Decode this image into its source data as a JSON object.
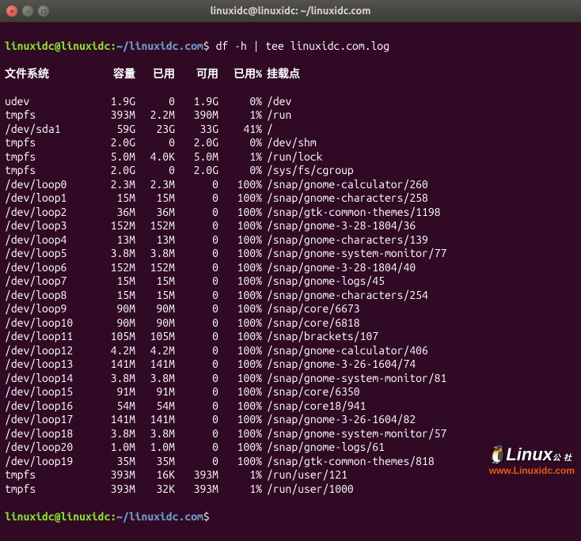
{
  "window": {
    "title": "linuxidc@linuxidc: ~/linuxidc.com"
  },
  "prompt": {
    "user_host": "linuxidc@linuxidc",
    "colon": ":",
    "path": "~/linuxidc.com",
    "dollar": "$",
    "command": "df -h | tee linuxidc.com.log"
  },
  "headers": {
    "filesystem": "文件系统",
    "size": "容量",
    "used": "已用",
    "avail": "可用",
    "use_pct": "已用%",
    "mount": "挂载点"
  },
  "rows": [
    {
      "fs": "udev",
      "size": "1.9G",
      "used": "0",
      "avail": "1.9G",
      "pct": "0%",
      "mnt": "/dev"
    },
    {
      "fs": "tmpfs",
      "size": "393M",
      "used": "2.2M",
      "avail": "390M",
      "pct": "1%",
      "mnt": "/run"
    },
    {
      "fs": "/dev/sda1",
      "size": "59G",
      "used": "23G",
      "avail": "33G",
      "pct": "41%",
      "mnt": "/"
    },
    {
      "fs": "tmpfs",
      "size": "2.0G",
      "used": "0",
      "avail": "2.0G",
      "pct": "0%",
      "mnt": "/dev/shm"
    },
    {
      "fs": "tmpfs",
      "size": "5.0M",
      "used": "4.0K",
      "avail": "5.0M",
      "pct": "1%",
      "mnt": "/run/lock"
    },
    {
      "fs": "tmpfs",
      "size": "2.0G",
      "used": "0",
      "avail": "2.0G",
      "pct": "0%",
      "mnt": "/sys/fs/cgroup"
    },
    {
      "fs": "/dev/loop0",
      "size": "2.3M",
      "used": "2.3M",
      "avail": "0",
      "pct": "100%",
      "mnt": "/snap/gnome-calculator/260"
    },
    {
      "fs": "/dev/loop1",
      "size": "15M",
      "used": "15M",
      "avail": "0",
      "pct": "100%",
      "mnt": "/snap/gnome-characters/258"
    },
    {
      "fs": "/dev/loop2",
      "size": "36M",
      "used": "36M",
      "avail": "0",
      "pct": "100%",
      "mnt": "/snap/gtk-common-themes/1198"
    },
    {
      "fs": "/dev/loop3",
      "size": "152M",
      "used": "152M",
      "avail": "0",
      "pct": "100%",
      "mnt": "/snap/gnome-3-28-1804/36"
    },
    {
      "fs": "/dev/loop4",
      "size": "13M",
      "used": "13M",
      "avail": "0",
      "pct": "100%",
      "mnt": "/snap/gnome-characters/139"
    },
    {
      "fs": "/dev/loop5",
      "size": "3.8M",
      "used": "3.8M",
      "avail": "0",
      "pct": "100%",
      "mnt": "/snap/gnome-system-monitor/77"
    },
    {
      "fs": "/dev/loop6",
      "size": "152M",
      "used": "152M",
      "avail": "0",
      "pct": "100%",
      "mnt": "/snap/gnome-3-28-1804/40"
    },
    {
      "fs": "/dev/loop7",
      "size": "15M",
      "used": "15M",
      "avail": "0",
      "pct": "100%",
      "mnt": "/snap/gnome-logs/45"
    },
    {
      "fs": "/dev/loop8",
      "size": "15M",
      "used": "15M",
      "avail": "0",
      "pct": "100%",
      "mnt": "/snap/gnome-characters/254"
    },
    {
      "fs": "/dev/loop9",
      "size": "90M",
      "used": "90M",
      "avail": "0",
      "pct": "100%",
      "mnt": "/snap/core/6673"
    },
    {
      "fs": "/dev/loop10",
      "size": "90M",
      "used": "90M",
      "avail": "0",
      "pct": "100%",
      "mnt": "/snap/core/6818"
    },
    {
      "fs": "/dev/loop11",
      "size": "105M",
      "used": "105M",
      "avail": "0",
      "pct": "100%",
      "mnt": "/snap/brackets/107"
    },
    {
      "fs": "/dev/loop12",
      "size": "4.2M",
      "used": "4.2M",
      "avail": "0",
      "pct": "100%",
      "mnt": "/snap/gnome-calculator/406"
    },
    {
      "fs": "/dev/loop13",
      "size": "141M",
      "used": "141M",
      "avail": "0",
      "pct": "100%",
      "mnt": "/snap/gnome-3-26-1604/74"
    },
    {
      "fs": "/dev/loop14",
      "size": "3.8M",
      "used": "3.8M",
      "avail": "0",
      "pct": "100%",
      "mnt": "/snap/gnome-system-monitor/81"
    },
    {
      "fs": "/dev/loop15",
      "size": "91M",
      "used": "91M",
      "avail": "0",
      "pct": "100%",
      "mnt": "/snap/core/6350"
    },
    {
      "fs": "/dev/loop16",
      "size": "54M",
      "used": "54M",
      "avail": "0",
      "pct": "100%",
      "mnt": "/snap/core18/941"
    },
    {
      "fs": "/dev/loop17",
      "size": "141M",
      "used": "141M",
      "avail": "0",
      "pct": "100%",
      "mnt": "/snap/gnome-3-26-1604/82"
    },
    {
      "fs": "/dev/loop18",
      "size": "3.8M",
      "used": "3.8M",
      "avail": "0",
      "pct": "100%",
      "mnt": "/snap/gnome-system-monitor/57"
    },
    {
      "fs": "/dev/loop20",
      "size": "1.0M",
      "used": "1.0M",
      "avail": "0",
      "pct": "100%",
      "mnt": "/snap/gnome-logs/61"
    },
    {
      "fs": "/dev/loop19",
      "size": "35M",
      "used": "35M",
      "avail": "0",
      "pct": "100%",
      "mnt": "/snap/gtk-common-themes/818"
    },
    {
      "fs": "tmpfs",
      "size": "393M",
      "used": "16K",
      "avail": "393M",
      "pct": "1%",
      "mnt": "/run/user/121"
    },
    {
      "fs": "tmpfs",
      "size": "393M",
      "used": "32K",
      "avail": "393M",
      "pct": "1%",
      "mnt": "/run/user/1000"
    }
  ],
  "watermark": {
    "logo": "Linux",
    "cn": "公社",
    "url": "www.Linuxidc.com"
  }
}
